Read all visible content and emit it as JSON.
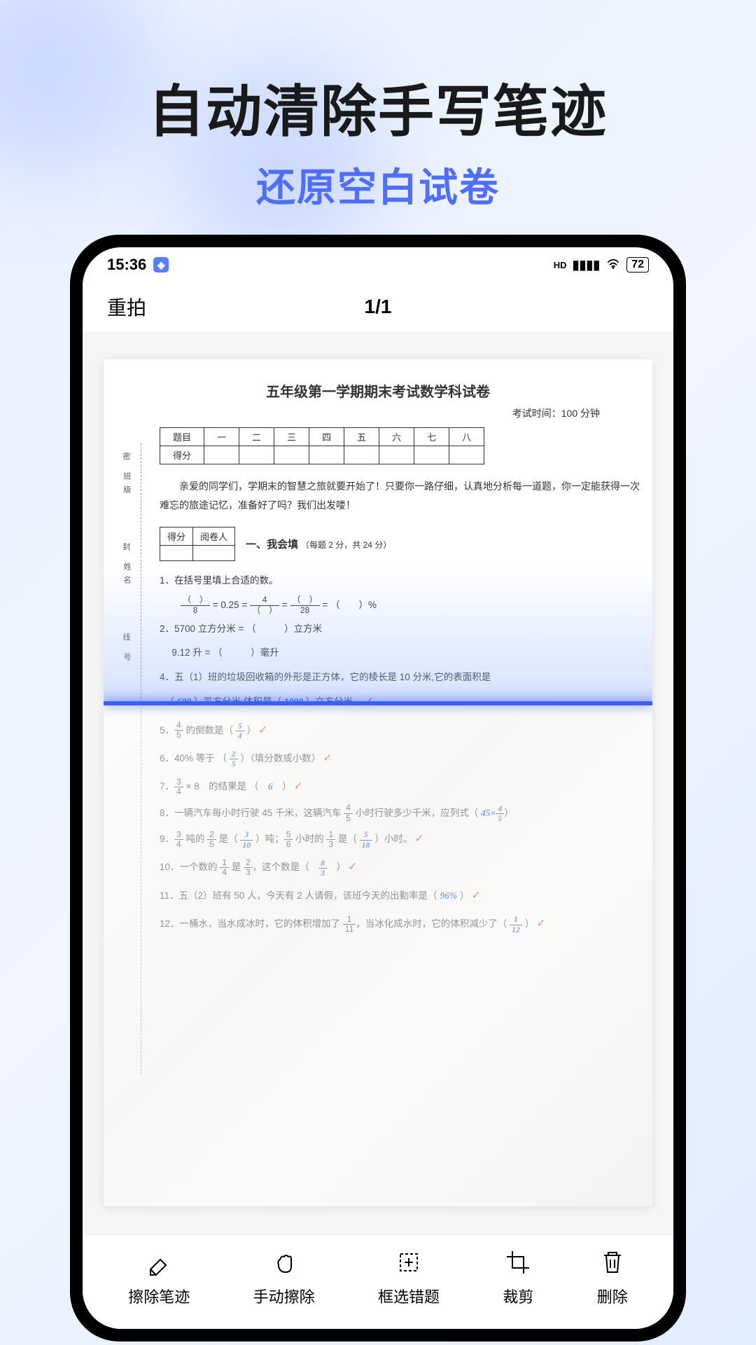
{
  "hero": {
    "title": "自动清除手写笔迹",
    "subtitle": "还原空白试卷"
  },
  "statusBar": {
    "time": "15:36",
    "hd": "HD",
    "battery": "72"
  },
  "appHeader": {
    "retake": "重拍",
    "pageCounter": "1/1"
  },
  "exam": {
    "title": "五年级第一学期期末考试数学科试卷",
    "time": "考试时间：100 分钟",
    "headerRow": [
      "题目",
      "一",
      "二",
      "三",
      "四",
      "五",
      "六",
      "七",
      "八"
    ],
    "scoreLabel": "得分",
    "sideLabels": {
      "class": "班级",
      "seal": "密",
      "name": "姓名",
      "feng": "封",
      "xian": "线",
      "hao": "号"
    },
    "intro": "亲爱的同学们，学期末的智慧之旅就要开始了！只要你一路仔细，认真地分析每一道题，你一定能获得一次难忘的旅途记忆，准备好了吗？我们出发喽！",
    "miniHeaders": [
      "得分",
      "阅卷人"
    ],
    "section1Title": "一、我会填",
    "section1Sub": "（每题 2 分，共 24 分）",
    "q1": "1．在括号里填上合适的数。",
    "q1formula_a": "= 0.25 =",
    "q1formula_b": "=",
    "q1formula_c": "= （　　）%",
    "q2a": "2．5700 立方分米 = （　　　）立方米",
    "q2b": "　 9.12 升 = （　　　）毫升",
    "q4": "4．五（1）班的垃圾回收箱的外形是正方体，它的棱长是 10 分米,它的表面积是",
    "q4b_prefix": "（ ",
    "q4b_ans1": "600",
    "q4b_mid": " ）平方分米,体积是（ ",
    "q4b_ans2": "1000",
    "q4b_suffix": " ）立方分米。",
    "q5_prefix": "5．",
    "q5_mid": " 的倒数是（ ",
    "q5_suffix": " ）",
    "q6_prefix": "6．40% 等于 （ ",
    "q6_suffix": " ）（填分数或小数）",
    "q7_prefix": "7．",
    "q7_mid": " × 8　的结果是 （　",
    "q7_ans": "6",
    "q7_suffix": "　）",
    "q8_prefix": "8．一辆汽车每小时行驶 45 千米，这辆汽车 ",
    "q8_mid": " 小时行驶多少千米，应列式（ ",
    "q8_ans": "45×",
    "q8_suffix": "）",
    "q9_prefix": "9．",
    "q9_a": " 吨的 ",
    "q9_b": " 是（ ",
    "q9_c": " ）吨；",
    "q9_d": " 小时的 ",
    "q9_e": " 是（ ",
    "q9_f": " ）小时。",
    "q10_prefix": "10．一个数的 ",
    "q10_a": " 是 ",
    "q10_b": "，这个数是（　",
    "q10_suffix": "　）",
    "q11_prefix": "11．五（2）班有 50 人，今天有 2 人请假，该班今天的出勤率是（ ",
    "q11_ans": "96%",
    "q11_suffix": " ）",
    "q12_prefix": "12．一桶水，当水成冰时，它的体积增加了 ",
    "q12_mid": "，当冰化成水时，它的体积减少了（ ",
    "q12_suffix": " ）"
  },
  "toolbar": {
    "erase": "擦除笔迹",
    "manual": "手动擦除",
    "select": "框选错题",
    "crop": "裁剪",
    "delete": "删除"
  }
}
